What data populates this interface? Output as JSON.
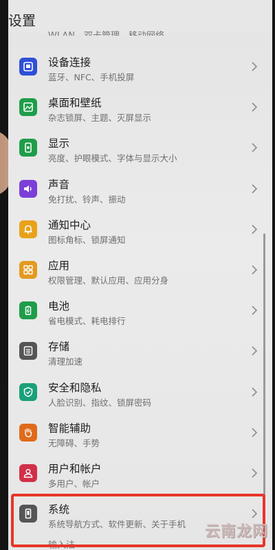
{
  "header": {
    "title": "设置",
    "cut_item": "WLAN、双卡管理、移动网络"
  },
  "items": [
    {
      "title": "设备连接",
      "subtitle": "蓝牙、NFC、手机投屏",
      "icon": "device-connection-icon",
      "color": "#2f4fd6"
    },
    {
      "title": "桌面和壁纸",
      "subtitle": "杂志锁屏、主题、灭屏显示",
      "icon": "wallpaper-icon",
      "color": "#1f9d4a"
    },
    {
      "title": "显示",
      "subtitle": "亮度、护眼模式、字体与显示大小",
      "icon": "display-icon",
      "color": "#1f9d4a"
    },
    {
      "title": "声音",
      "subtitle": "免打扰、铃声、振动",
      "icon": "sound-icon",
      "color": "#7b3fd8"
    },
    {
      "title": "通知中心",
      "subtitle": "图标角标、锁屏通知",
      "icon": "notification-bell-icon",
      "color": "#e9a21b"
    },
    {
      "title": "应用",
      "subtitle": "权限管理、默认应用、应用分身",
      "icon": "apps-grid-icon",
      "color": "#e39a20"
    },
    {
      "title": "电池",
      "subtitle": "省电模式、耗电排行",
      "icon": "battery-icon",
      "color": "#1f9d4a"
    },
    {
      "title": "存储",
      "subtitle": "清理加速",
      "icon": "storage-icon",
      "color": "#555555"
    },
    {
      "title": "安全和隐私",
      "subtitle": "人脸识别、指纹、锁屏密码",
      "icon": "shield-icon",
      "color": "#1aa07a"
    },
    {
      "title": "智能辅助",
      "subtitle": "无障碍、手势",
      "icon": "hand-icon",
      "color": "#e06a1b"
    },
    {
      "title": "用户和帐户",
      "subtitle": "多用户、帐户",
      "icon": "user-icon",
      "color": "#d12f4a"
    },
    {
      "title": "系统",
      "subtitle": "系统导航方式、软件更新、关于手机",
      "icon": "system-phone-icon",
      "color": "#555555"
    }
  ],
  "system_extra_line": "输入法",
  "watermark": "云南龙网",
  "highlight_color": "#e7362a"
}
